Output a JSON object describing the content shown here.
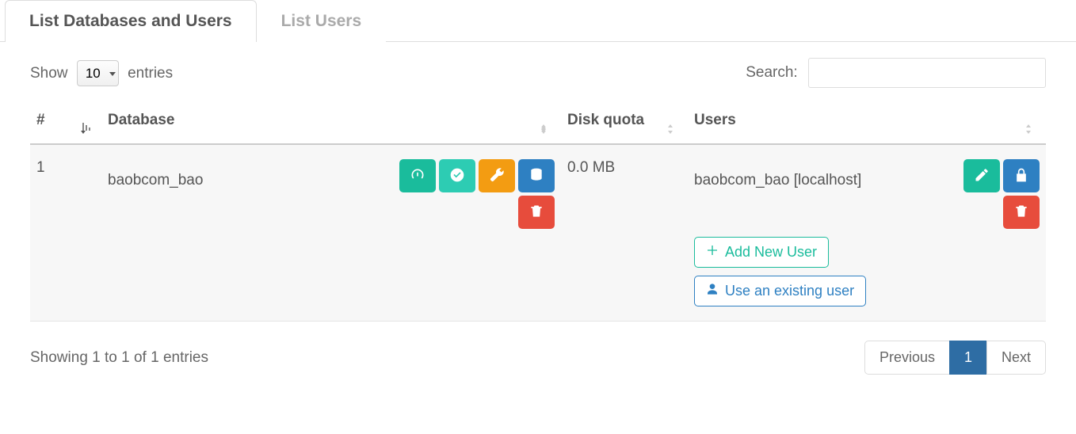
{
  "tabs": [
    {
      "label": "List Databases and Users",
      "active": true
    },
    {
      "label": "List Users",
      "active": false
    }
  ],
  "lengthMenu": {
    "prefix": "Show",
    "suffix": "entries",
    "value": "10"
  },
  "search": {
    "label": "Search:",
    "value": ""
  },
  "columns": {
    "num": "#",
    "database": "Database",
    "disk": "Disk quota",
    "users": "Users"
  },
  "rows": [
    {
      "num": "1",
      "database": "baobcom_bao",
      "disk": "0.0 MB",
      "user": "baobcom_bao [localhost]"
    }
  ],
  "userButtons": {
    "add": "Add New User",
    "existing": "Use an existing user"
  },
  "info": "Showing 1 to 1 of 1 entries",
  "pager": {
    "prev": "Previous",
    "page": "1",
    "next": "Next"
  }
}
